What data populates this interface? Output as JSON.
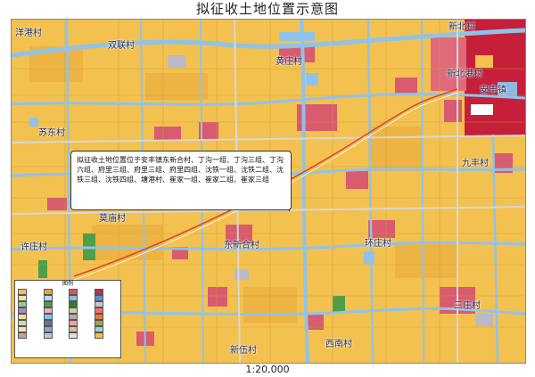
{
  "title": "拟征收土地位置示意图",
  "scale": "1:20,000",
  "villages": [
    "洋港村",
    "双联村",
    "黄庄村",
    "新北港村",
    "安丰镇",
    "新北村",
    "苏东村",
    "九丰村",
    "莫庙村",
    "许庄村",
    "东新合村",
    "环庄村",
    "三庄村",
    "西南村",
    "新伍村"
  ],
  "callout": {
    "text": "拟征收土地位置位于安丰镇东新合村、丁沟一组、丁沟三组、丁沟六组、府里三组、府里三组、府里四组、沈铁一组、沈铁二组、沈铁三组、沈铁四组、塘港村、崔家一组、崔家二组、崔家三组"
  },
  "legend": {
    "title": "图例",
    "swatch_colors": [
      "#f3c14f",
      "#e6a23c",
      "#d8566a",
      "#c03040",
      "#f0e2a0",
      "#b9d8f0",
      "#8fb8e0",
      "#5b8fd0",
      "#9ac98a",
      "#4f9e4a",
      "#2e7d32",
      "#c8c8c8",
      "#a88cc8",
      "#e8b0c8",
      "#d0d0a0",
      "#ff6f6f",
      "#f7dca0",
      "#7ec8e3",
      "#b0b0b0",
      "#e07a3a",
      "#c2e2a8",
      "#6f6f9f",
      "#f4a0a0",
      "#a0a060",
      "#f9e0b0",
      "#88a8c8",
      "#d8c090",
      "#9fd0c0",
      "#c8a0a0",
      "#b0c8e8",
      "#e0e0e0",
      "#ffb84d"
    ]
  },
  "colors": {
    "farmland": "#f3c14f",
    "water": "#8fc3ea",
    "road": "#c9c9c9",
    "residential": "#d95b6e",
    "town": "#c51f3a",
    "boundary": "#e0472b",
    "label": "#1e2a5a"
  }
}
